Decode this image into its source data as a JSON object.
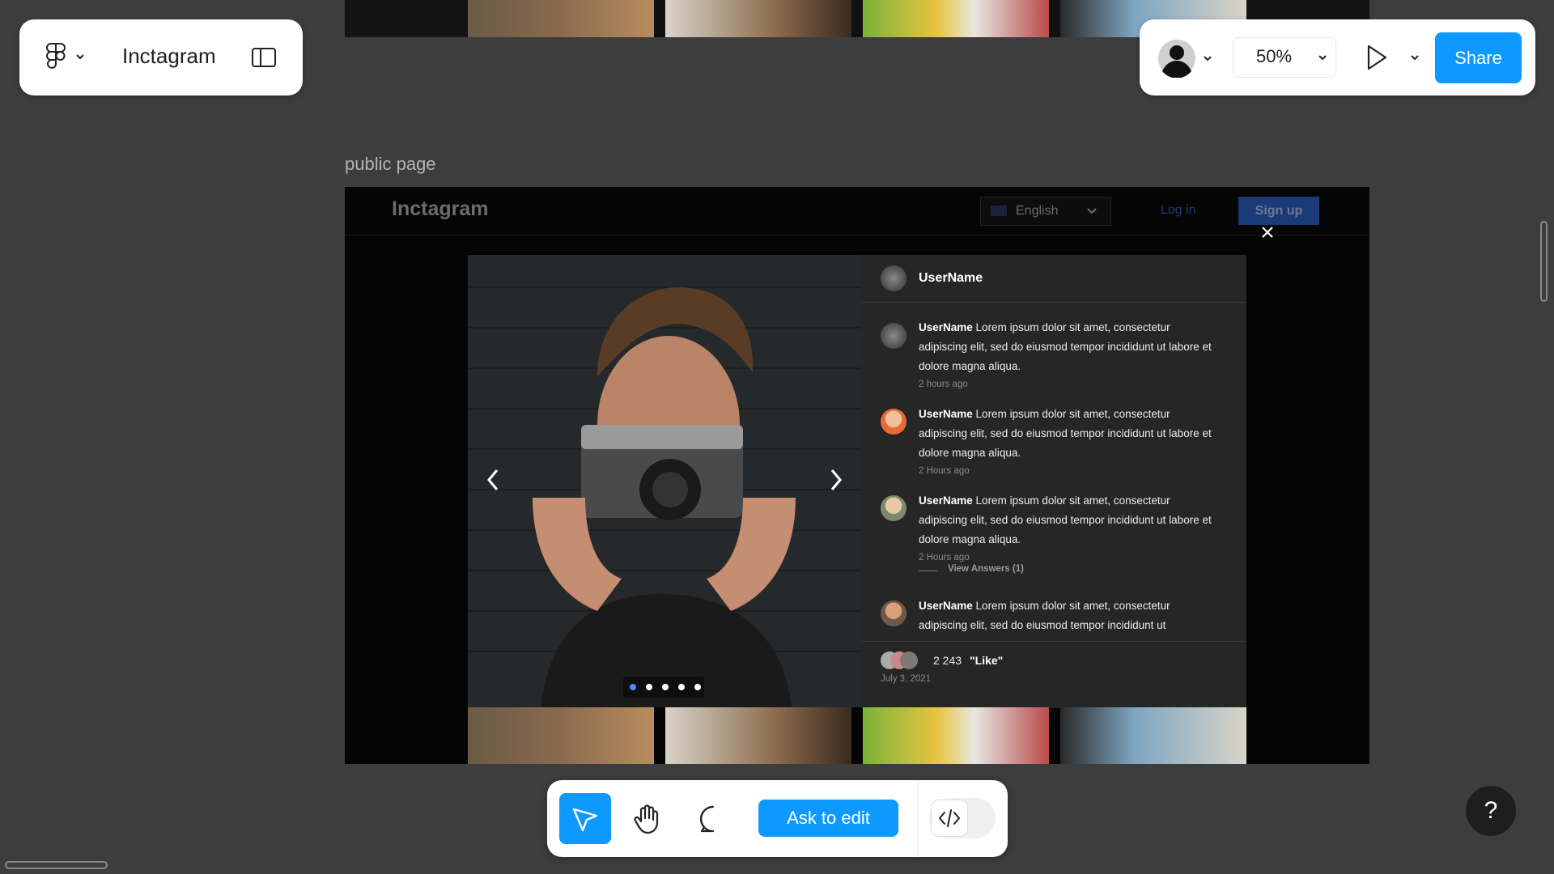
{
  "app": {
    "file_name": "Inctagram"
  },
  "header_right": {
    "zoom": "50%",
    "share_label": "Share"
  },
  "frame": {
    "label": "public page"
  },
  "site": {
    "brand": "Inctagram",
    "language": "English",
    "login": "Log in",
    "signup": "Sign up"
  },
  "post": {
    "author": "UserName",
    "slides_total": 5,
    "slide_active": 1,
    "comments": [
      {
        "user": "UserName",
        "text": " Lorem ipsum dolor sit amet, consectetur adipiscing elit, sed do eiusmod tempor incididunt ut labore et dolore magna aliqua.",
        "time": "2 hours ago"
      },
      {
        "user": "UserName",
        "text": " Lorem ipsum dolor sit amet, consectetur adipiscing elit, sed do eiusmod tempor incididunt ut labore et dolore magna aliqua.",
        "time": "2 Hours ago"
      },
      {
        "user": "UserName",
        "text": " Lorem ipsum dolor sit amet, consectetur adipiscing elit, sed do eiusmod tempor incididunt ut labore et dolore magna aliqua.",
        "time": "2 Hours ago",
        "answers": "View Answers (1)"
      },
      {
        "user": "UserName",
        "text": " Lorem ipsum dolor sit amet, consectetur adipiscing elit, sed do eiusmod tempor incididunt ut",
        "time": ""
      }
    ],
    "likes_count": "2 243",
    "likes_label": "\"Like\"",
    "date": "July 3, 2021"
  },
  "toolbar": {
    "ask_label": "Ask to edit"
  },
  "help": {
    "label": "?"
  },
  "colors": {
    "accent": "#0d99ff",
    "canvas": "#3d3d3d",
    "panel": "#262626"
  }
}
